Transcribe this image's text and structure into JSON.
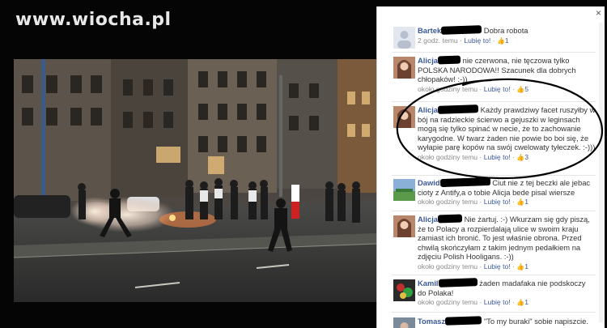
{
  "watermark": "www.wiocha.pl",
  "close_glyph": "×",
  "comments": [
    {
      "name": "Bartek",
      "text": "Dobra robota",
      "time": "2 godz. temu",
      "like_label": "Lubię to!",
      "likes": "1"
    },
    {
      "name": "Alicja",
      "text": "nie czerwona, nie tęczowa tylko POLSKA NARODOWA!! Szacunek dla dobrych chłopaków! :-))",
      "time": "około godziny temu",
      "like_label": "Lubię to!",
      "likes": "5"
    },
    {
      "name": "Alicja",
      "text": "Każdy prawdziwy facet ruszyłby w bój na radzieckie ścierwo a gejuszki w leginsach mogą się tylko spinać w necie, że to zachowanie karygodne. W twarz żaden nie powie bo boi się, że wyłapie parę kopów na swój cwelowaty tyłeczek. :-)))",
      "time": "około godziny temu",
      "like_label": "Lubię to!",
      "likes": "3"
    },
    {
      "name": "Dawid",
      "text": "Ciut nie z tej beczki ale jebac cioty z Antify,a o tobie Alicja bede pisal wiersze",
      "time": "około godziny temu",
      "like_label": "Lubię to!",
      "likes": "1"
    },
    {
      "name": "Alicja",
      "text": "Nie żartuj. :-) Wkurzam się gdy piszą, że to Polacy a rozpierdalają ulice w swoim kraju zamiast ich bronić. To jest właśnie obrona. Przed chwilą skończyłam z takim jednym pedałkiem na zdjęciu Polish Hooligans. :-))",
      "time": "około godziny temu",
      "like_label": "Lubię to!",
      "likes": "1"
    },
    {
      "name": "Kamil",
      "text": "żaden madafaka nie podskoczy do Polaka!",
      "time": "około godziny temu",
      "like_label": "Lubię to!",
      "likes": "1"
    },
    {
      "name": "Tomasz",
      "text": "\"To my buraki\" sobie napiszcie.",
      "time": "",
      "like_label": "",
      "likes": ""
    }
  ],
  "colors": {
    "link": "#3b5998",
    "highlight_circle": "#000000"
  },
  "icons": {
    "like": "thumbs-up-icon",
    "close": "close-icon"
  }
}
